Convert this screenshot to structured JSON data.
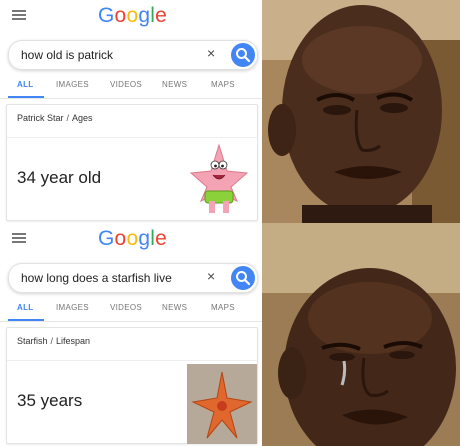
{
  "panels": [
    {
      "logo": [
        "G",
        "o",
        "o",
        "g",
        "l",
        "e"
      ],
      "query": "how old is patrick",
      "clear_symbol": "×",
      "tabs": [
        "ALL",
        "IMAGES",
        "VIDEOS",
        "NEWS",
        "MAPS"
      ],
      "breadcrumb_subject": "Patrick Star",
      "breadcrumb_sep": "/",
      "breadcrumb_attr": "Ages",
      "answer": "34 year old",
      "image_icon": "patrick-star-icon"
    },
    {
      "logo": [
        "G",
        "o",
        "o",
        "g",
        "l",
        "e"
      ],
      "query": "how long does a starfish live",
      "clear_symbol": "×",
      "tabs": [
        "ALL",
        "IMAGES",
        "VIDEOS",
        "NEWS",
        "MAPS"
      ],
      "breadcrumb_subject": "Starfish",
      "breadcrumb_sep": "/",
      "breadcrumb_attr": "Lifespan",
      "answer": "35 years",
      "image_icon": "starfish-icon"
    }
  ],
  "colors": {
    "google_blue": "#4285f4",
    "google_red": "#ea4335",
    "google_yellow": "#fbbc05",
    "google_green": "#34a853"
  }
}
